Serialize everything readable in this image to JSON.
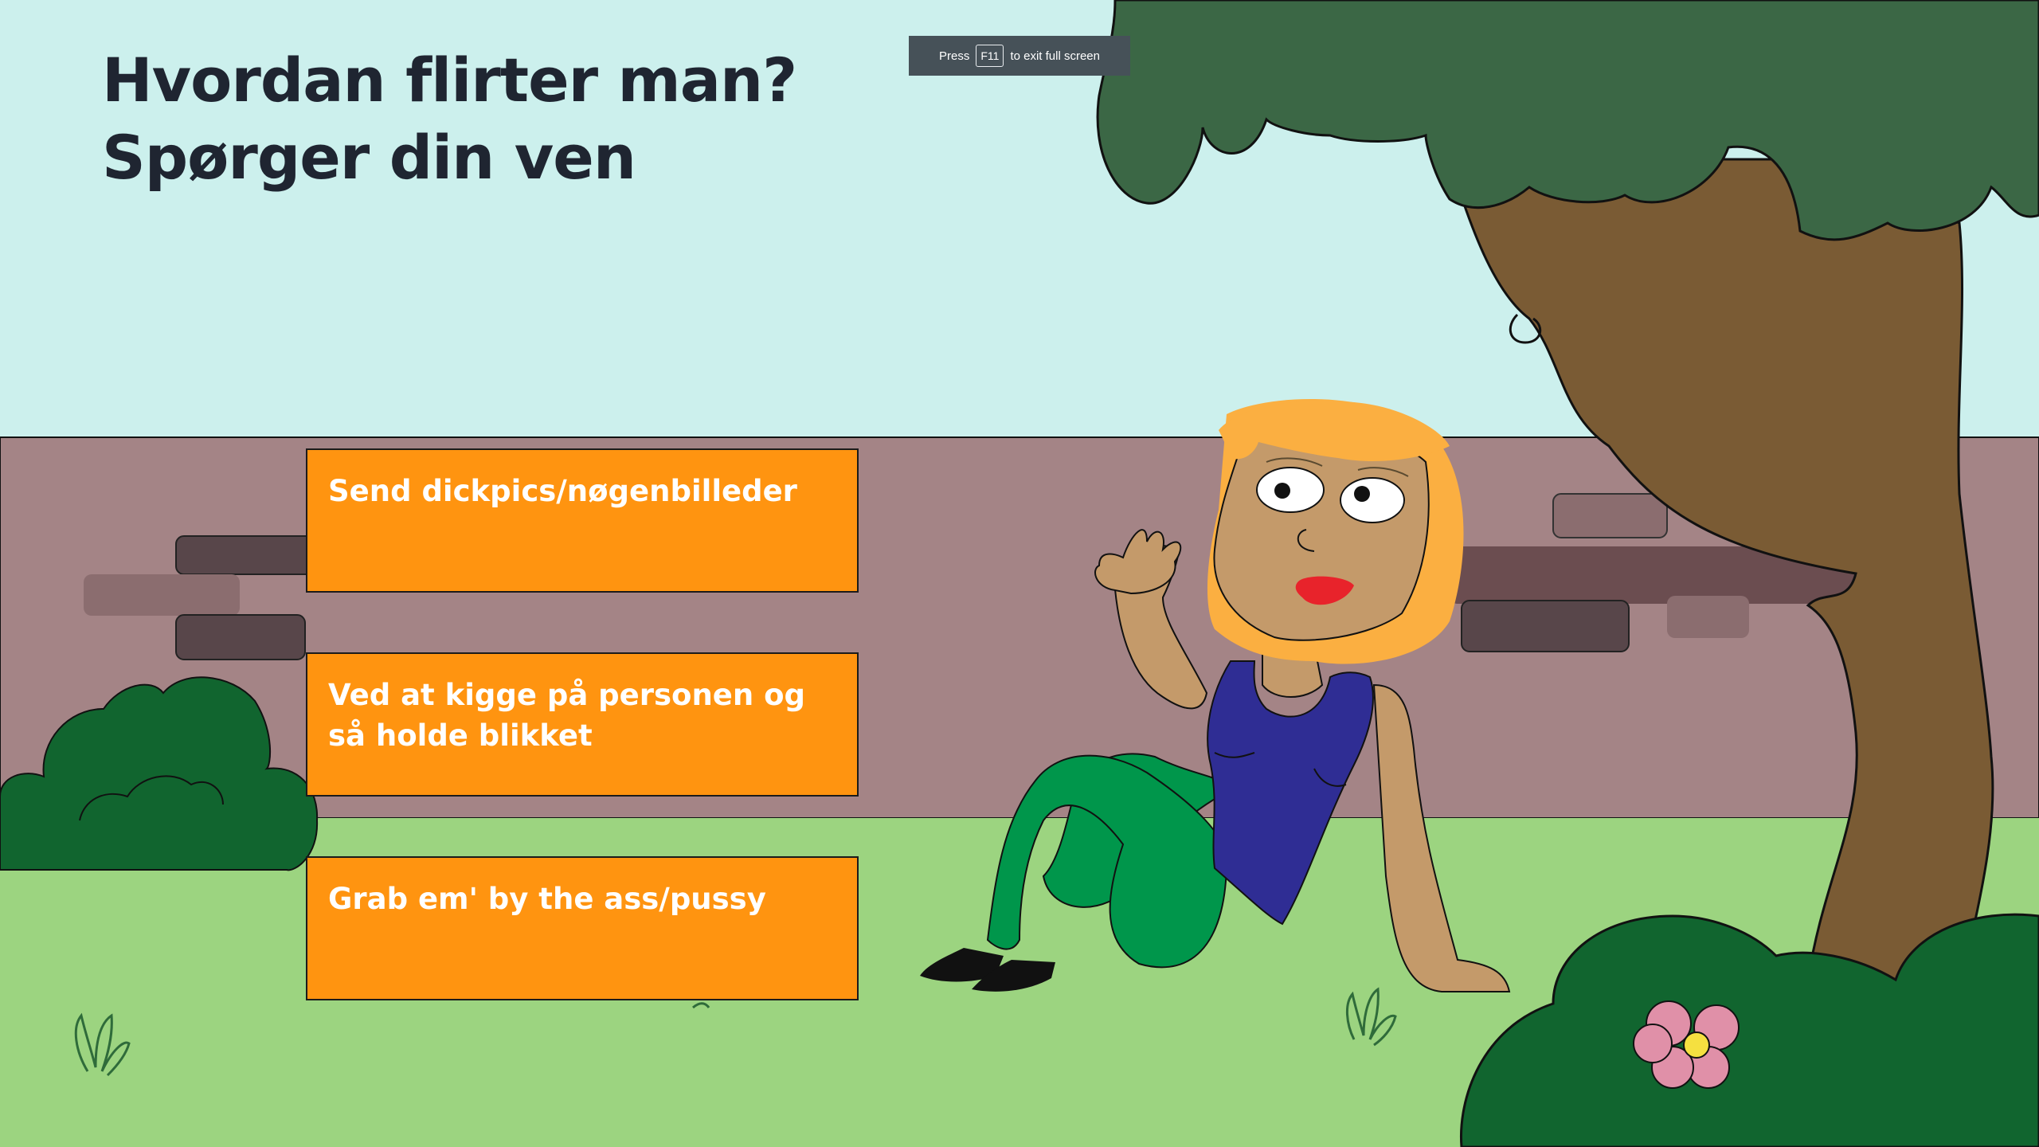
{
  "question": {
    "line1": "Hvordan flirter man?",
    "line2": "Spørger din ven"
  },
  "fullscreen_notice": {
    "before": "Press",
    "key": "F11",
    "after": "to exit full screen"
  },
  "choices": [
    {
      "label": "Send dickpics/nøgenbilleder"
    },
    {
      "label": "Ved at kigge på personen og så holde blikket"
    },
    {
      "label": "Grab em' by the ass/pussy"
    }
  ],
  "colors": {
    "sky": "#ccf0ed",
    "wall": "#a48486",
    "grass": "#9cd480",
    "choice_bg": "#ff9410",
    "title_text": "#1f2531",
    "tree_leaves": "#3b6745",
    "tree_trunk": "#7a5b34",
    "bush": "#2a7a3f"
  }
}
